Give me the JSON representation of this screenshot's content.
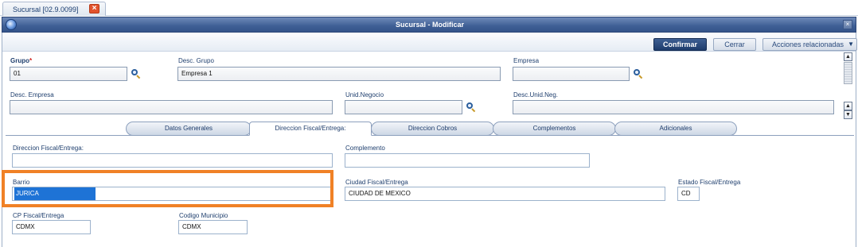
{
  "doc_tab": {
    "label": "Sucursal [02.9.0099]",
    "close_glyph": "×"
  },
  "window": {
    "title": "Sucursal - Modificar",
    "close_glyph": "×",
    "icon": "globe-icon"
  },
  "toolbar": {
    "confirm_label": "Confirmar",
    "close_label": "Cerrar",
    "actions_label": "Acciones relacionadas",
    "actions_arrow": "▼"
  },
  "header_fields": {
    "grupo": {
      "label": "Grupo",
      "required_mark": "*",
      "value": "01"
    },
    "desc_grupo": {
      "label": "Desc. Grupo",
      "value": "Empresa 1"
    },
    "empresa": {
      "label": "Empresa",
      "value": ""
    },
    "desc_empresa": {
      "label": "Desc. Empresa",
      "value": ""
    },
    "unid_negocio": {
      "label": "Unid.Negocio",
      "value": ""
    },
    "desc_unid_neg": {
      "label": "Desc.Unid.Neg.",
      "value": ""
    }
  },
  "scrollbar": {
    "up_glyph": "▲",
    "down_glyph": "▼"
  },
  "tabs": [
    {
      "label": "Datos Generales",
      "active": false
    },
    {
      "label": "Direccion Fiscal/Entrega:",
      "active": true
    },
    {
      "label": "Direccion Cobros",
      "active": false
    },
    {
      "label": "Complementos",
      "active": false
    },
    {
      "label": "Adicionales",
      "active": false
    }
  ],
  "address_fields": {
    "direccion": {
      "label": "Direccion Fiscal/Entrega:",
      "value": ""
    },
    "complemento": {
      "label": "Complemento",
      "value": ""
    },
    "barrio": {
      "label": "Barrio",
      "value": "JURICA"
    },
    "ciudad": {
      "label": "Ciudad Fiscal/Entrega",
      "value": "CIUDAD DE MEXICO"
    },
    "estado": {
      "label": "Estado Fiscal/Entrega",
      "value": "CD"
    },
    "cp": {
      "label": "CP Fiscal/Entrega",
      "value": "CDMX"
    },
    "municipio": {
      "label": "Codigo Municipio",
      "value": "CDMX"
    }
  },
  "colors": {
    "accent": "#1e3c6c",
    "highlight": "#f08126",
    "selection": "#1e73d6"
  }
}
